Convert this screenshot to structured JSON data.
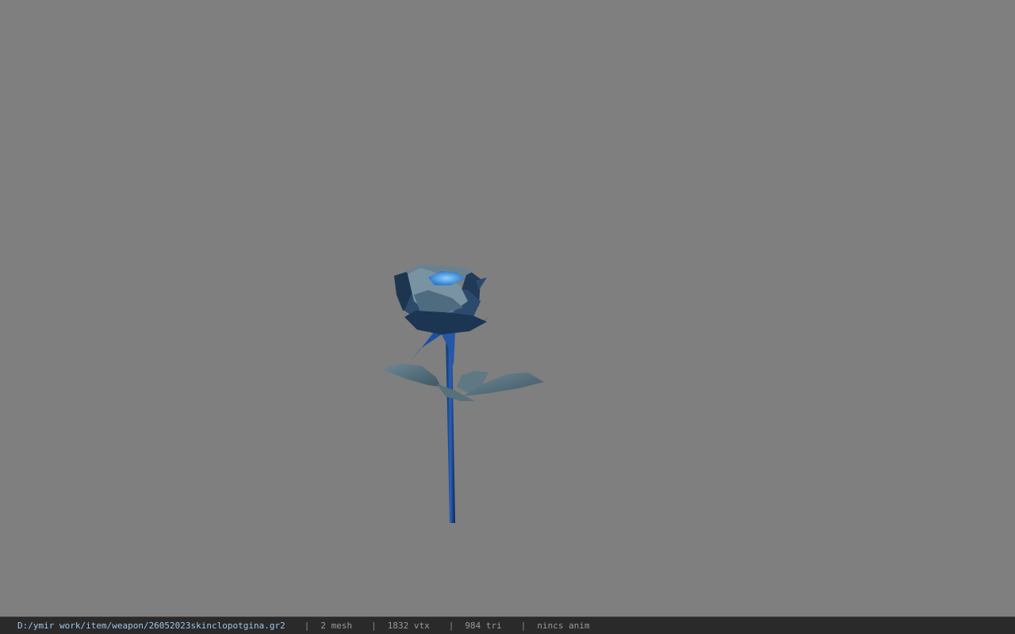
{
  "viewport": {
    "background_color": "#7f7f7f",
    "model_icon": "rose-3d-model"
  },
  "status_bar": {
    "file_path": "D:/ymir work/item/weapon/26052023skinclopotgina.gr2",
    "separator": "|",
    "mesh_count": "2 mesh",
    "vertex_count": "1832 vtx",
    "triangle_count": "984 tri",
    "animation": "nincs anim"
  },
  "colors": {
    "path_text": "#9fc6e6",
    "stat_text": "#9a9a9a",
    "bar_background": "#2a2a2a"
  }
}
